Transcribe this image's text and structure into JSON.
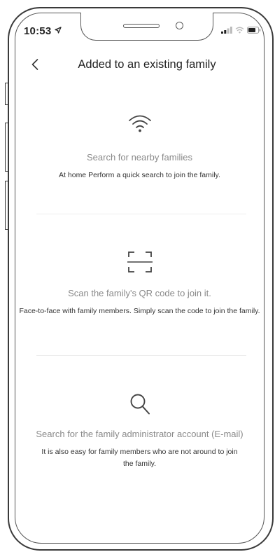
{
  "status_bar": {
    "time": "10:53",
    "location_icon": "location-arrow-icon",
    "signal_icon": "cellular-signal-icon",
    "wifi_icon": "wifi-icon",
    "battery_icon": "battery-icon"
  },
  "header": {
    "back_icon": "chevron-left-icon",
    "title": "Added to an existing family"
  },
  "options": [
    {
      "icon": "wifi-icon",
      "title": "Search for nearby families",
      "description": "At home Perform a quick search to join the family."
    },
    {
      "icon": "qr-scan-icon",
      "title": "Scan the family's QR code to join it.",
      "description": "Face-to-face with family members. Simply scan the code to join the family."
    },
    {
      "icon": "search-icon",
      "title": "Search for the family administrator account (E-mail)",
      "description": "It is also easy for family members who are not around to join the family."
    }
  ],
  "colors": {
    "title_text": "#222222",
    "option_title": "#8a8a8a",
    "option_desc": "#333333",
    "divider": "#ededed",
    "frame": "#3a3a3a"
  }
}
